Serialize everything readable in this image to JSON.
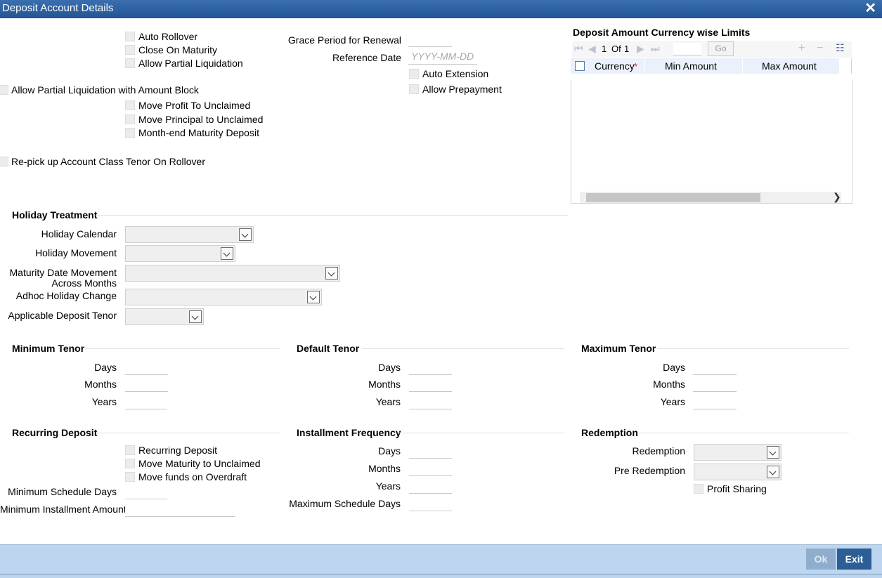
{
  "window": {
    "title": "Deposit Account Details",
    "close_glyph": "✕"
  },
  "options": {
    "auto_rollover": "Auto Rollover",
    "close_on_maturity": "Close On Maturity",
    "allow_partial_liquidation": "Allow Partial Liquidation",
    "allow_partial_liquidation_amount_block": "Allow Partial Liquidation with Amount Block",
    "move_profit_to_unclaimed": "Move Profit To Unclaimed",
    "move_principal_to_unclaimed": "Move Principal to Unclaimed",
    "month_end_maturity_deposit": "Month-end Maturity Deposit",
    "repick_tenor": "Re-pick up Account Class Tenor On Rollover",
    "grace_period_label": "Grace Period for Renewal",
    "grace_period_value": "",
    "reference_date_label": "Reference Date",
    "reference_date_placeholder": "YYYY-MM-DD",
    "auto_extension": "Auto Extension",
    "allow_prepayment": "Allow Prepayment"
  },
  "limits_grid": {
    "title": "Deposit Amount Currency wise Limits",
    "page_current": "1",
    "page_of": "Of",
    "page_total": "1",
    "go_label": "Go",
    "columns": {
      "currency": "Currency",
      "required_mark": "*",
      "min_amount": "Min Amount",
      "max_amount": "Max Amount"
    },
    "rows": []
  },
  "holiday": {
    "section": "Holiday Treatment",
    "calendar_label": "Holiday Calendar",
    "movement_label": "Holiday Movement",
    "maturity_move_label_1": "Maturity Date Movement",
    "maturity_move_label_2": "Across Months",
    "adhoc_label": "Adhoc Holiday Change",
    "tenor_label": "Applicable Deposit Tenor"
  },
  "tenor": {
    "minimum": "Minimum Tenor",
    "default": "Default Tenor",
    "maximum": "Maximum Tenor",
    "days": "Days",
    "months": "Months",
    "years": "Years"
  },
  "recurring": {
    "section": "Recurring Deposit",
    "recurring_deposit": "Recurring Deposit",
    "move_maturity_unclaimed": "Move Maturity to Unclaimed",
    "move_funds_overdraft": "Move funds on Overdraft",
    "min_schedule_days": "Minimum Schedule Days",
    "min_installment_amount": "Minimum Installment Amount"
  },
  "installment": {
    "section": "Installment Frequency",
    "days": "Days",
    "months": "Months",
    "years": "Years",
    "max_schedule_days": "Maximum Schedule Days"
  },
  "redemption": {
    "section": "Redemption",
    "redemption_label": "Redemption",
    "pre_redemption_label": "Pre Redemption",
    "profit_sharing": "Profit Sharing"
  },
  "footer": {
    "ok": "Ok",
    "exit": "Exit"
  }
}
